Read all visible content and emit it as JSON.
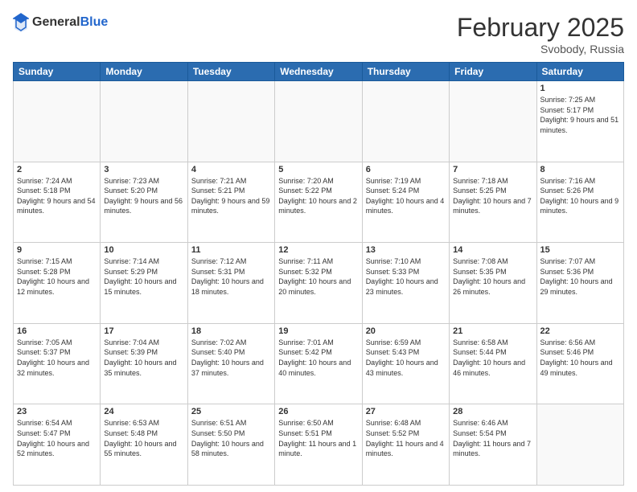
{
  "header": {
    "logo_general": "General",
    "logo_blue": "Blue",
    "month_year": "February 2025",
    "location": "Svobody, Russia"
  },
  "days_of_week": [
    "Sunday",
    "Monday",
    "Tuesday",
    "Wednesday",
    "Thursday",
    "Friday",
    "Saturday"
  ],
  "weeks": [
    [
      {
        "day": "",
        "info": ""
      },
      {
        "day": "",
        "info": ""
      },
      {
        "day": "",
        "info": ""
      },
      {
        "day": "",
        "info": ""
      },
      {
        "day": "",
        "info": ""
      },
      {
        "day": "",
        "info": ""
      },
      {
        "day": "1",
        "info": "Sunrise: 7:25 AM\nSunset: 5:17 PM\nDaylight: 9 hours and 51 minutes."
      }
    ],
    [
      {
        "day": "2",
        "info": "Sunrise: 7:24 AM\nSunset: 5:18 PM\nDaylight: 9 hours and 54 minutes."
      },
      {
        "day": "3",
        "info": "Sunrise: 7:23 AM\nSunset: 5:20 PM\nDaylight: 9 hours and 56 minutes."
      },
      {
        "day": "4",
        "info": "Sunrise: 7:21 AM\nSunset: 5:21 PM\nDaylight: 9 hours and 59 minutes."
      },
      {
        "day": "5",
        "info": "Sunrise: 7:20 AM\nSunset: 5:22 PM\nDaylight: 10 hours and 2 minutes."
      },
      {
        "day": "6",
        "info": "Sunrise: 7:19 AM\nSunset: 5:24 PM\nDaylight: 10 hours and 4 minutes."
      },
      {
        "day": "7",
        "info": "Sunrise: 7:18 AM\nSunset: 5:25 PM\nDaylight: 10 hours and 7 minutes."
      },
      {
        "day": "8",
        "info": "Sunrise: 7:16 AM\nSunset: 5:26 PM\nDaylight: 10 hours and 9 minutes."
      }
    ],
    [
      {
        "day": "9",
        "info": "Sunrise: 7:15 AM\nSunset: 5:28 PM\nDaylight: 10 hours and 12 minutes."
      },
      {
        "day": "10",
        "info": "Sunrise: 7:14 AM\nSunset: 5:29 PM\nDaylight: 10 hours and 15 minutes."
      },
      {
        "day": "11",
        "info": "Sunrise: 7:12 AM\nSunset: 5:31 PM\nDaylight: 10 hours and 18 minutes."
      },
      {
        "day": "12",
        "info": "Sunrise: 7:11 AM\nSunset: 5:32 PM\nDaylight: 10 hours and 20 minutes."
      },
      {
        "day": "13",
        "info": "Sunrise: 7:10 AM\nSunset: 5:33 PM\nDaylight: 10 hours and 23 minutes."
      },
      {
        "day": "14",
        "info": "Sunrise: 7:08 AM\nSunset: 5:35 PM\nDaylight: 10 hours and 26 minutes."
      },
      {
        "day": "15",
        "info": "Sunrise: 7:07 AM\nSunset: 5:36 PM\nDaylight: 10 hours and 29 minutes."
      }
    ],
    [
      {
        "day": "16",
        "info": "Sunrise: 7:05 AM\nSunset: 5:37 PM\nDaylight: 10 hours and 32 minutes."
      },
      {
        "day": "17",
        "info": "Sunrise: 7:04 AM\nSunset: 5:39 PM\nDaylight: 10 hours and 35 minutes."
      },
      {
        "day": "18",
        "info": "Sunrise: 7:02 AM\nSunset: 5:40 PM\nDaylight: 10 hours and 37 minutes."
      },
      {
        "day": "19",
        "info": "Sunrise: 7:01 AM\nSunset: 5:42 PM\nDaylight: 10 hours and 40 minutes."
      },
      {
        "day": "20",
        "info": "Sunrise: 6:59 AM\nSunset: 5:43 PM\nDaylight: 10 hours and 43 minutes."
      },
      {
        "day": "21",
        "info": "Sunrise: 6:58 AM\nSunset: 5:44 PM\nDaylight: 10 hours and 46 minutes."
      },
      {
        "day": "22",
        "info": "Sunrise: 6:56 AM\nSunset: 5:46 PM\nDaylight: 10 hours and 49 minutes."
      }
    ],
    [
      {
        "day": "23",
        "info": "Sunrise: 6:54 AM\nSunset: 5:47 PM\nDaylight: 10 hours and 52 minutes."
      },
      {
        "day": "24",
        "info": "Sunrise: 6:53 AM\nSunset: 5:48 PM\nDaylight: 10 hours and 55 minutes."
      },
      {
        "day": "25",
        "info": "Sunrise: 6:51 AM\nSunset: 5:50 PM\nDaylight: 10 hours and 58 minutes."
      },
      {
        "day": "26",
        "info": "Sunrise: 6:50 AM\nSunset: 5:51 PM\nDaylight: 11 hours and 1 minute."
      },
      {
        "day": "27",
        "info": "Sunrise: 6:48 AM\nSunset: 5:52 PM\nDaylight: 11 hours and 4 minutes."
      },
      {
        "day": "28",
        "info": "Sunrise: 6:46 AM\nSunset: 5:54 PM\nDaylight: 11 hours and 7 minutes."
      },
      {
        "day": "",
        "info": ""
      }
    ]
  ]
}
